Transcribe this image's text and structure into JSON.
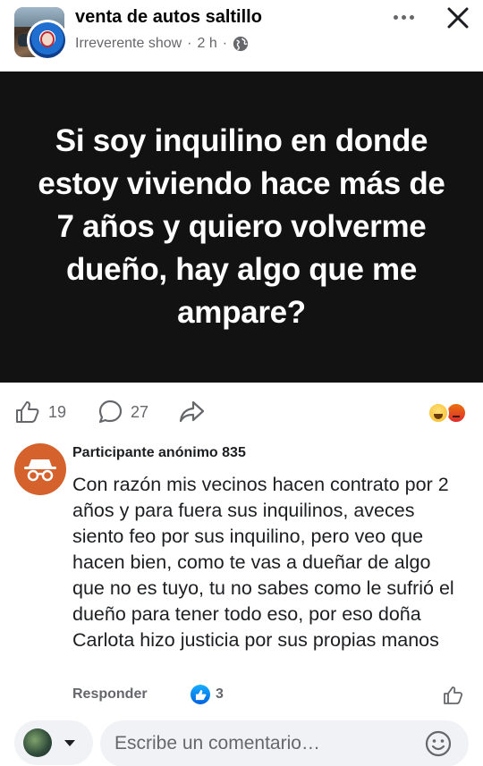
{
  "header": {
    "group_name": "venta de autos saltillo",
    "author": "Irreverente show",
    "separator": "·",
    "time": "2 h"
  },
  "post": {
    "text": "Si soy inquilino en donde estoy viviendo hace más de 7 años y quiero volverme dueño, hay algo que me ampare?"
  },
  "reactions": {
    "likes": "19",
    "comments": "27"
  },
  "comment": {
    "author": "Participante anónimo 835",
    "text": "Con razón mis vecinos hacen contrato por 2 años y para fuera sus inquilinos, aveces siento feo por sus inquilino, pero veo que hacen bien, como te vas a dueñar de algo que no es tuyo, tu no sabes como le sufrió el dueño para tener todo eso, por eso doña Carlota hizo justicia por sus propias manos",
    "reply_label": "Responder",
    "like_count": "3"
  },
  "composer": {
    "placeholder": "Escribe un comentario…"
  },
  "colors": {
    "image_bg": "#121212",
    "secondary_text": "#65676b",
    "anon_avatar": "#d5622c",
    "like_blue": "#0866ff"
  }
}
